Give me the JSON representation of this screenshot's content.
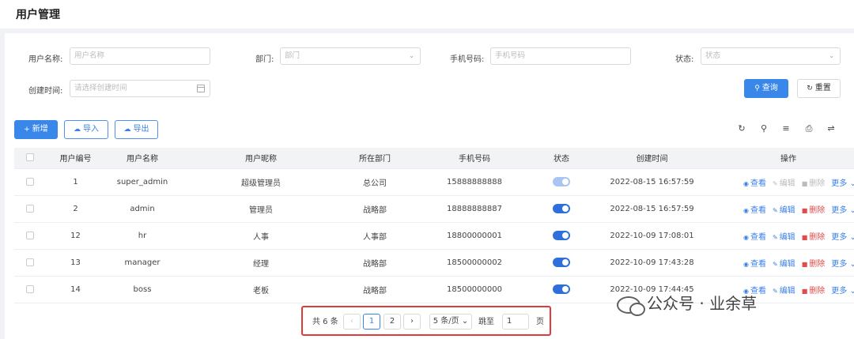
{
  "page": {
    "title": "用户管理"
  },
  "search": {
    "username_label": "用户名称:",
    "username_placeholder": "用户名称",
    "dept_label": "部门:",
    "dept_placeholder": "部门",
    "phone_label": "手机号码:",
    "phone_placeholder": "手机号码",
    "status_label": "状态:",
    "status_placeholder": "状态",
    "created_label": "创建时间:",
    "created_placeholder": "请选择创建时间",
    "query_label": "查询",
    "reset_label": "重置"
  },
  "toolbar": {
    "add_label": "新增",
    "import_label": "导入",
    "export_label": "导出"
  },
  "table": {
    "headers": [
      "用户编号",
      "用户名称",
      "用户昵称",
      "所在部门",
      "手机号码",
      "状态",
      "创建时间",
      "操作"
    ],
    "rows": [
      {
        "id": "1",
        "username": "super_admin",
        "nickname": "超级管理员",
        "dept": "总公司",
        "phone": "15888888888",
        "enabled": true,
        "locked": true,
        "created": "2022-08-15 16:57:59"
      },
      {
        "id": "2",
        "username": "admin",
        "nickname": "管理员",
        "dept": "战略部",
        "phone": "18888888887",
        "enabled": true,
        "locked": false,
        "created": "2022-08-15 16:57:59"
      },
      {
        "id": "12",
        "username": "hr",
        "nickname": "人事",
        "dept": "人事部",
        "phone": "18800000001",
        "enabled": true,
        "locked": false,
        "created": "2022-10-09 17:08:01"
      },
      {
        "id": "13",
        "username": "manager",
        "nickname": "经理",
        "dept": "战略部",
        "phone": "18500000002",
        "enabled": true,
        "locked": false,
        "created": "2022-10-09 17:43:28"
      },
      {
        "id": "14",
        "username": "boss",
        "nickname": "老板",
        "dept": "战略部",
        "phone": "18500000000",
        "enabled": true,
        "locked": false,
        "created": "2022-10-09 17:44:45"
      }
    ],
    "ops": {
      "view": "查看",
      "edit": "编辑",
      "delete": "删除",
      "more": "更多"
    }
  },
  "pagination": {
    "total_text": "共 6 条",
    "pages": [
      "1",
      "2"
    ],
    "current_page": "1",
    "page_size": "5 条/页",
    "jump_label": "跳至",
    "jump_value": "1",
    "page_suffix": "页"
  },
  "watermark": {
    "text": "公众号 · 业余草"
  },
  "colors": {
    "primary": "#3a87ea",
    "danger": "#e24b4b",
    "highlight_border": "#e03a3a"
  }
}
